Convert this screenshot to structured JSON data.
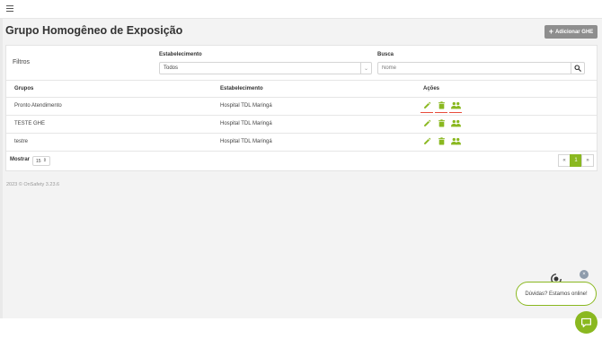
{
  "header": {
    "menu_icon": "hamburger-icon"
  },
  "page": {
    "title": "Grupo Homogêneo de Exposição",
    "add_button_label": "Adicionar GHE",
    "add_icon": "plus-icon"
  },
  "filters": {
    "title": "Filtros",
    "establishment_label": "Estabelecimento",
    "establishment_value": "Todos",
    "search_label": "Busca",
    "search_placeholder": "Nome",
    "search_icon": "magnifier-icon"
  },
  "table": {
    "columns": [
      "Grupos",
      "Estabelecimento",
      "Ações"
    ],
    "rows": [
      {
        "group": "Pronto Atendimento",
        "establishment": "Hospital TDL Maringá"
      },
      {
        "group": "TESTE GHE",
        "establishment": "Hospital TDL Maringá"
      },
      {
        "group": "testre",
        "establishment": "Hospital TDL Maringá"
      }
    ],
    "action_icons": [
      "pencil-icon",
      "trash-icon",
      "users-icon"
    ]
  },
  "pagination": {
    "show_label": "Mostrar",
    "page_size": "15",
    "prev": "«",
    "current_page": "1",
    "next": "»"
  },
  "footer": {
    "text": "2023 © OnSafety 3.23.6"
  },
  "chat": {
    "bubble_text": "Dúvidas? Estamos online!",
    "close_label": "×"
  },
  "colors": {
    "accent": "#8ab820",
    "underline": "#e74c3c",
    "button_gray": "#8e8e8e"
  }
}
